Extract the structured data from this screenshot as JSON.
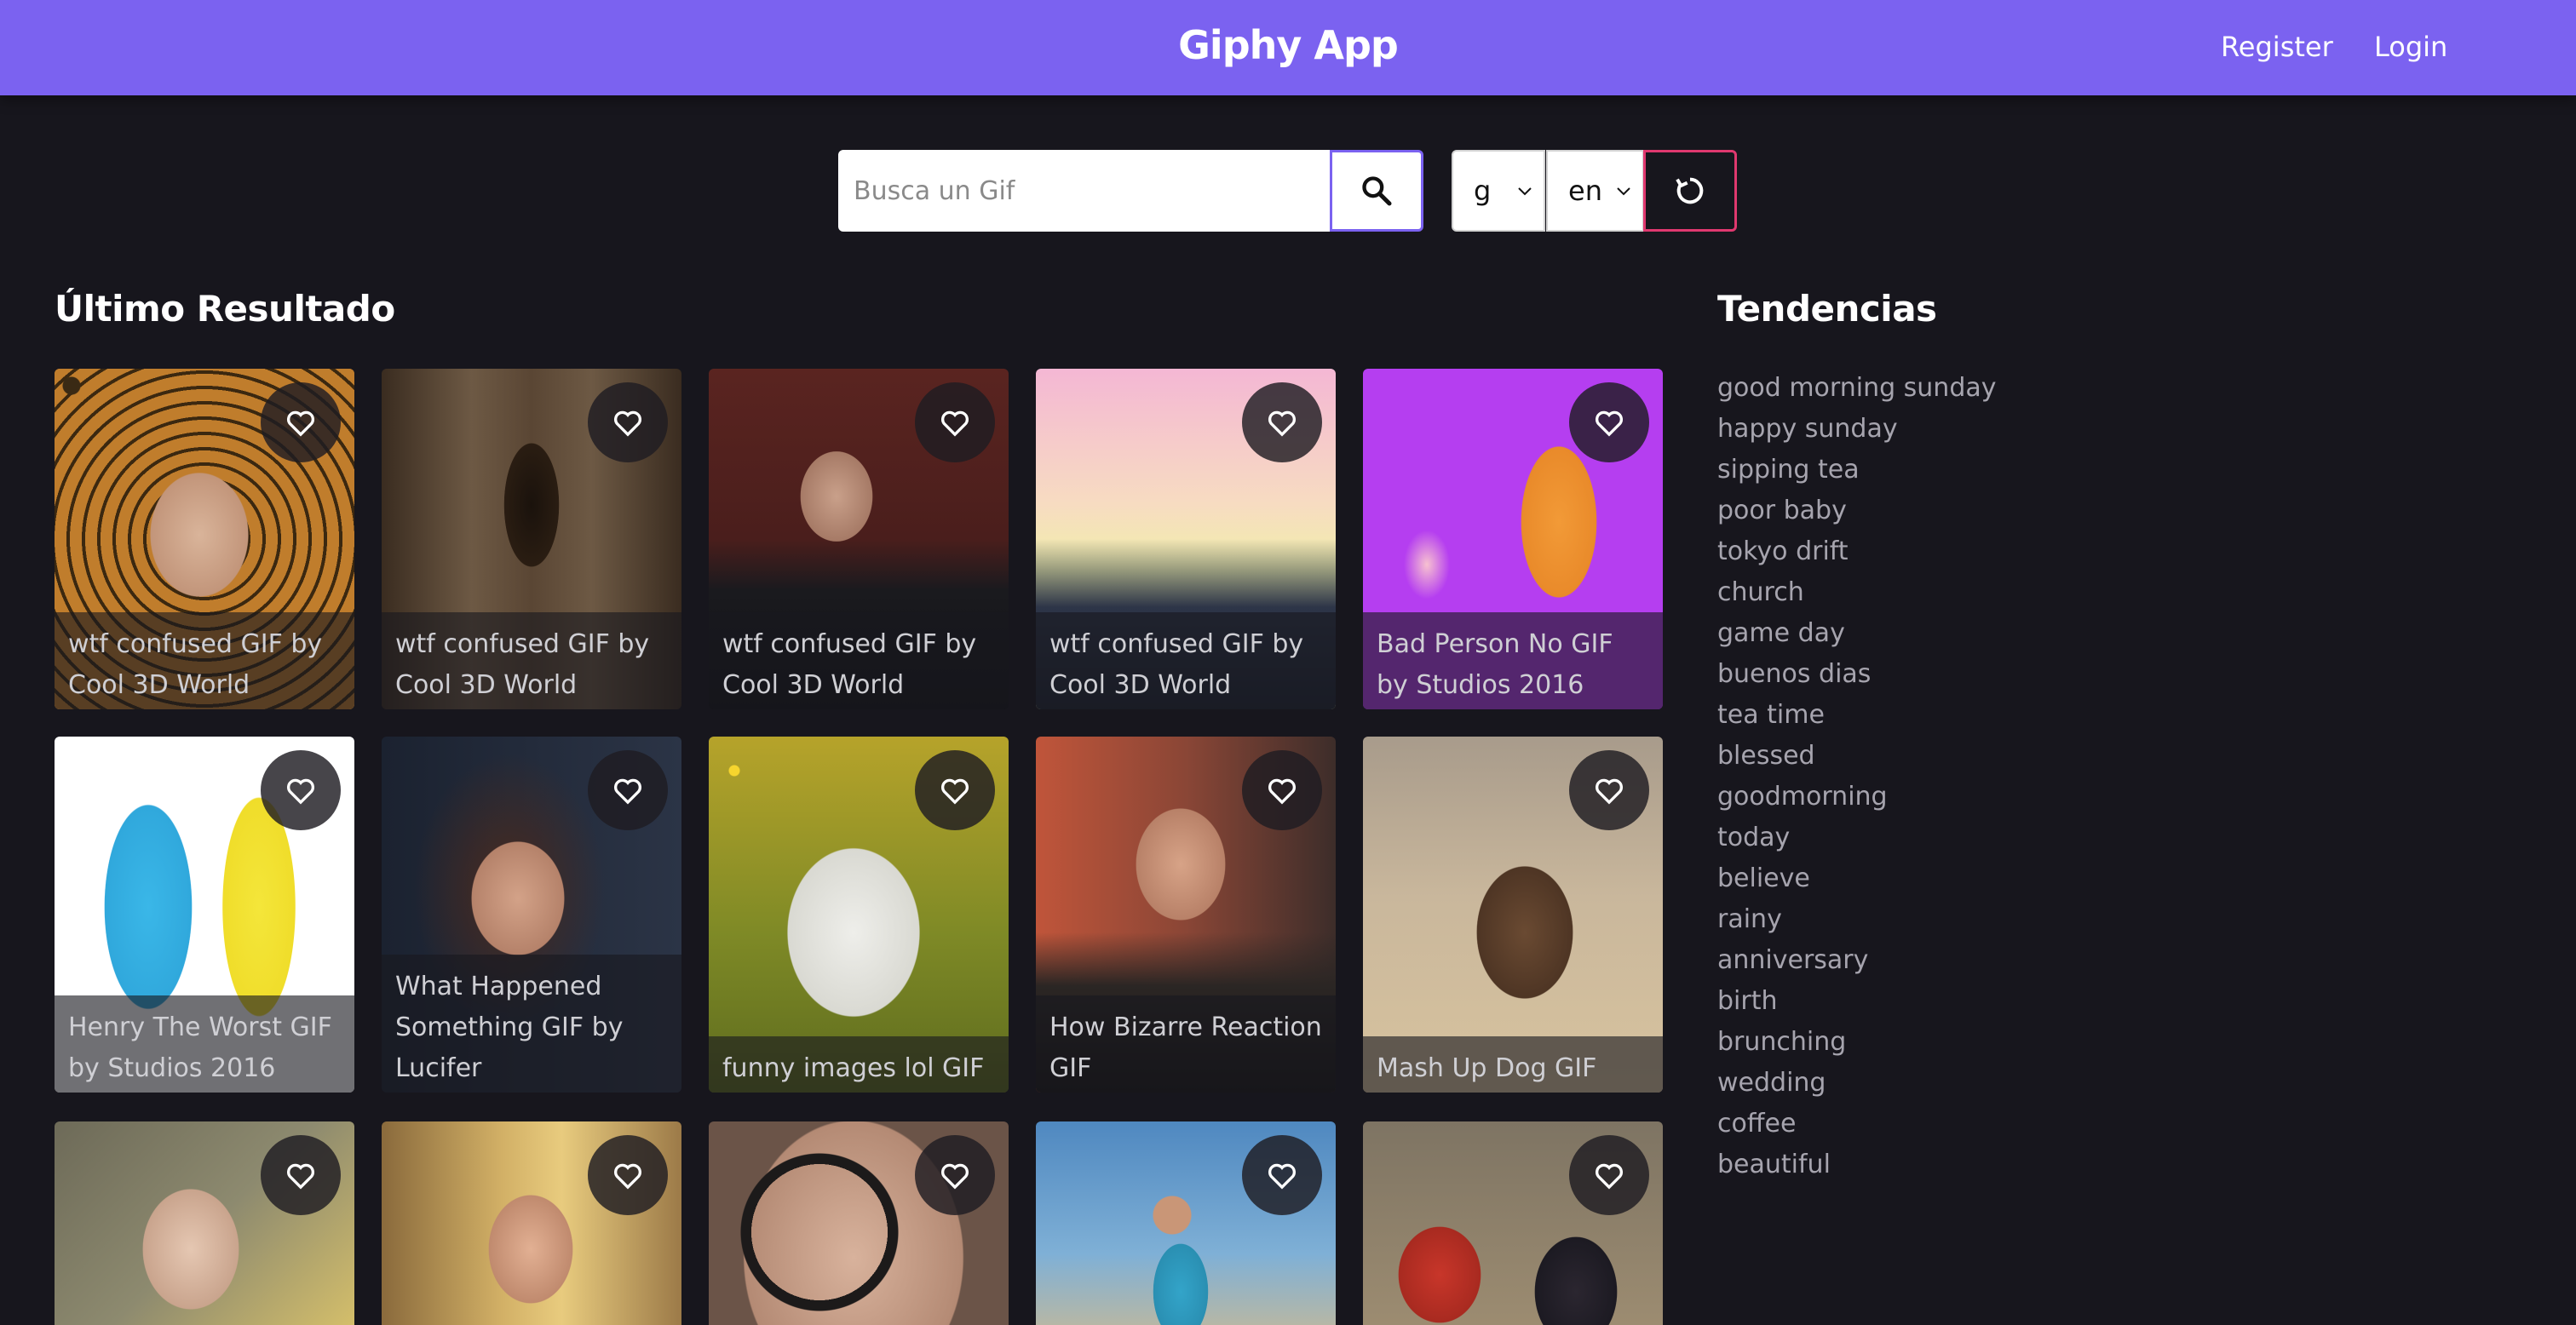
{
  "header": {
    "title": "Giphy App",
    "nav": {
      "register": "Register",
      "login": "Login"
    },
    "color": "#7b62f0"
  },
  "search": {
    "placeholder": "Busca un Gif",
    "value": "",
    "icon": "search-icon"
  },
  "filters": {
    "rating": {
      "selected": "g"
    },
    "language": {
      "selected": "en"
    },
    "reset_icon": "refresh-icon",
    "reset_color": "#e0386f"
  },
  "latest": {
    "title": "Último Resultado",
    "results": [
      {
        "caption": "wtf confused GIF by Cool 3D World"
      },
      {
        "caption": "wtf confused GIF by Cool 3D World"
      },
      {
        "caption": "wtf confused GIF by Cool 3D World"
      },
      {
        "caption": "wtf confused GIF by Cool 3D World"
      },
      {
        "caption": "Bad Person No GIF by Studios 2016"
      },
      {
        "caption": "Henry The Worst GIF by Studios 2016"
      },
      {
        "caption": "What Happened Something GIF by Lucifer"
      },
      {
        "caption": "funny images lol GIF"
      },
      {
        "caption": "How Bizarre Reaction GIF"
      },
      {
        "caption": "Mash Up Dog GIF"
      },
      {
        "caption": ""
      },
      {
        "caption": ""
      },
      {
        "caption": ""
      },
      {
        "caption": ""
      },
      {
        "caption": ""
      }
    ],
    "favorite_icon": "heart-icon"
  },
  "trends": {
    "title": "Tendencias",
    "items": [
      "good morning sunday",
      "happy sunday",
      "sipping tea",
      "poor baby",
      "tokyo drift",
      "church",
      "game day",
      "buenos dias",
      "tea time",
      "blessed",
      "goodmorning",
      "today",
      "believe",
      "rainy",
      "anniversary",
      "birth",
      "brunching",
      "wedding",
      "coffee",
      "beautiful"
    ]
  }
}
